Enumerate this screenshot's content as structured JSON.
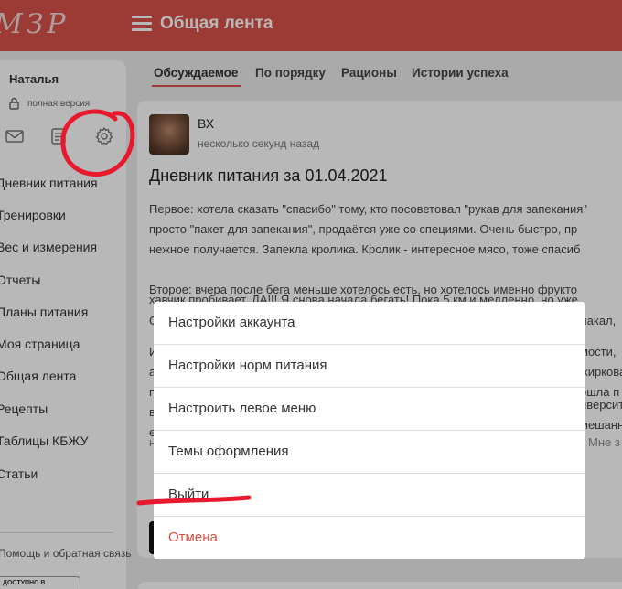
{
  "header": {
    "logo": "МЗР",
    "title": "Общая лента"
  },
  "sidebar": {
    "user_name": "Наталья",
    "version": "полная версия",
    "icons": [
      "mail-icon",
      "notes-icon",
      "gear-icon"
    ],
    "items": [
      {
        "label": "Дневник питания"
      },
      {
        "label": "Тренировки"
      },
      {
        "label": "Вес и измерения"
      },
      {
        "label": "Отчеты"
      },
      {
        "label": "Планы питания"
      },
      {
        "label": "Моя страница"
      },
      {
        "label": "Общая лента"
      },
      {
        "label": "Рецепты"
      },
      {
        "label": "Таблицы КБЖУ"
      },
      {
        "label": "Статьи"
      }
    ],
    "footer": "Помощь и обратная связь",
    "badge": "ДОСТУПНО В"
  },
  "tabs": [
    {
      "label": "Обсуждаемое",
      "active": true
    },
    {
      "label": "По порядку",
      "active": false
    },
    {
      "label": "Рационы",
      "active": false
    },
    {
      "label": "Истории успеха",
      "active": false
    }
  ],
  "post": {
    "author": "ВХ",
    "time": "несколько секунд назад",
    "title": "Дневник питания за 01.04.2021",
    "lines": [
      "Первое: хотела сказать \"спасибо\" тому, кто посоветовал \"рукав для запекания\"",
      "просто \"пакет для запекания\", продаётся уже со специями. Очень быстро, пр",
      "нежное получается. Запекла кролика. Кролик - интересное мясо, тоже спасиб",
      "Второе: вчера после бега меньше хотелось есть, но хотелось именно фрукто",
      "хавчик пробивает. ДА!!! Я снова начала бегать! Пока 5 км и медленно, но уже",
      "С",
      "И",
      "а",
      "п",
      "в",
      "е",
      "н"
    ],
    "right_fragments": [
      "плакал, ",
      "мости, ",
      "жиркова",
      "ошла п",
      "иверсит",
      "мешанна",
      "Мне з"
    ]
  },
  "action_sheet": {
    "items": [
      {
        "label": "Настройки аккаунта"
      },
      {
        "label": "Настройки норм питания"
      },
      {
        "label": "Настроить левое меню"
      },
      {
        "label": "Темы оформления"
      },
      {
        "label": "Выйти"
      }
    ],
    "cancel": "Отмена"
  },
  "colors": {
    "brand": "#d9534a",
    "cancel": "#e14b3e",
    "annotation": "#e8192c"
  }
}
